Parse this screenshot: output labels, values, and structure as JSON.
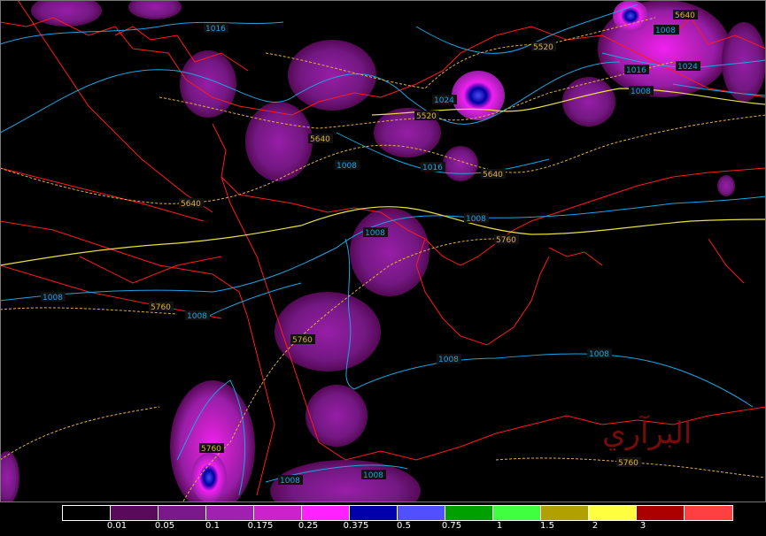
{
  "map": {
    "isobar_labels": [
      "1016",
      "1016",
      "1024",
      "1016",
      "1024",
      "1008",
      "1008",
      "1016",
      "1008",
      "1008",
      "1008",
      "1008",
      "1008",
      "1008",
      "1008",
      "1008",
      "1008"
    ],
    "height_labels": [
      "5640",
      "5520",
      "5520",
      "5640",
      "5640",
      "5640",
      "5760",
      "5760",
      "5760",
      "5760",
      "5760"
    ],
    "colors": {
      "coastline": "#ff1a1a",
      "isobar": "#1fa3e0",
      "height_contour": "#e0b040",
      "height_contour_5760": "#e8e040"
    },
    "watermark": "البرآري"
  },
  "legend": {
    "colors": [
      "#000000",
      "#5a0a5a",
      "#7a1a8a",
      "#a020b0",
      "#cc22cc",
      "#ff22ff",
      "#0000aa",
      "#5050ff",
      "#00a000",
      "#40ff40",
      "#b0a000",
      "#ffff40",
      "#aa0000",
      "#ff4040"
    ],
    "ticks": [
      "0.01",
      "0.05",
      "0.1",
      "0.175",
      "0.25",
      "0.375",
      "0.5",
      "0.75",
      "1",
      "1.5",
      "2",
      "3"
    ]
  }
}
